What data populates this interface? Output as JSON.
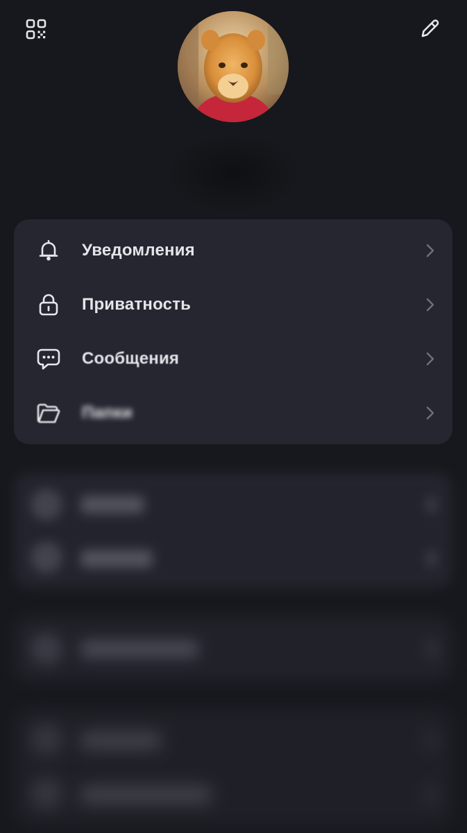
{
  "header": {
    "qr_icon": "qr-code-icon",
    "edit_icon": "pencil-icon",
    "avatar": "profile-avatar"
  },
  "settings": {
    "items": [
      {
        "label": "Уведомления",
        "icon": "bell-icon"
      },
      {
        "label": "Приватность",
        "icon": "lock-icon"
      },
      {
        "label": "Сообщения",
        "icon": "chat-bubble-icon"
      },
      {
        "label": "Папки",
        "icon": "folder-icon"
      }
    ]
  },
  "colors": {
    "background": "#17181d",
    "card": "#25262f",
    "text": "#e4e5ea",
    "muted": "#8b8c94"
  }
}
